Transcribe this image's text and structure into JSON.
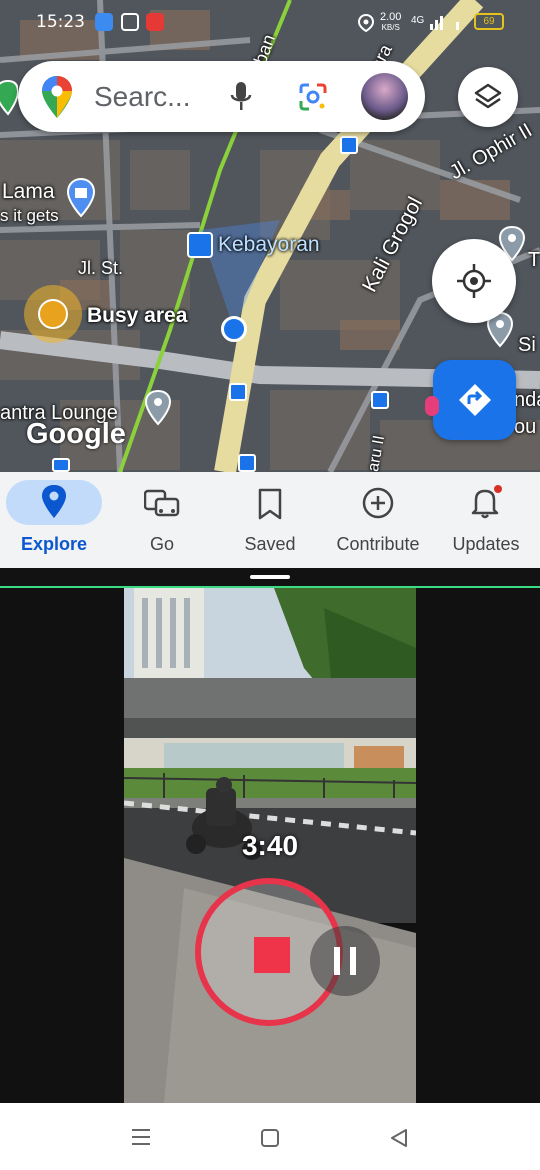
{
  "status_bar": {
    "time": "15:23",
    "net_speed": "2.00",
    "net_unit": "KB/S",
    "network": "4G",
    "battery": "69"
  },
  "search": {
    "placeholder": "Searc..."
  },
  "map_labels": {
    "lama": "Lama",
    "it_gets": "s it gets",
    "jl_st": "Jl. St.",
    "kebayoran": "Kebayoran",
    "busy_area": "Busy area",
    "kali_grogol": "Kali Grogol",
    "jl_ophir": "Jl. Ophir II",
    "antra_lounge": "antra Lounge",
    "ban": "ban",
    "ara": "ara",
    "aru": "aru II",
    "si": "Si",
    "t": "T",
    "nda": "nda",
    "ou": "ou",
    "google": "Google"
  },
  "bottom_nav": [
    {
      "label": "Explore",
      "icon": "pin-icon",
      "active": true
    },
    {
      "label": "Go",
      "icon": "commute-icon",
      "active": false
    },
    {
      "label": "Saved",
      "icon": "bookmark-icon",
      "active": false
    },
    {
      "label": "Contribute",
      "icon": "add-circle-icon",
      "active": false
    },
    {
      "label": "Updates",
      "icon": "bell-icon",
      "active": false
    }
  ],
  "recording": {
    "timer": "3:40"
  },
  "colors": {
    "accent": "#1a73e8",
    "record": "#e8344a",
    "split_line": "#3ddc84"
  }
}
